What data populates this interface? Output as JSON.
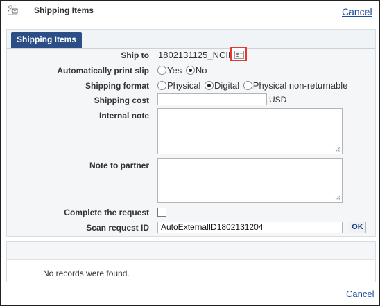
{
  "header": {
    "title": "Shipping Items",
    "cancel_label": "Cancel"
  },
  "tab": {
    "label": "Shipping Items"
  },
  "form": {
    "ship_to": {
      "label": "Ship to",
      "value": "1802131125_NCIF"
    },
    "auto_print": {
      "label": "Automatically print slip",
      "options": [
        "Yes",
        "No"
      ],
      "selected": "No"
    },
    "shipping_format": {
      "label": "Shipping format",
      "options": [
        "Physical",
        "Digital",
        "Physical non-returnable"
      ],
      "selected": "Digital"
    },
    "shipping_cost": {
      "label": "Shipping cost",
      "value": "",
      "currency": "USD"
    },
    "internal_note": {
      "label": "Internal note",
      "value": ""
    },
    "note_to_partner": {
      "label": "Note to partner",
      "value": ""
    },
    "complete_request": {
      "label": "Complete the request",
      "checked": false
    },
    "scan_request": {
      "label": "Scan request ID",
      "value": "AutoExternalID1802131204",
      "ok_label": "OK"
    }
  },
  "results": {
    "message": "No records were found."
  },
  "footer": {
    "cancel_label": "Cancel"
  },
  "colors": {
    "tab_bg": "#2c4e86",
    "link": "#1f4e9a",
    "highlight_border": "#e53935"
  }
}
